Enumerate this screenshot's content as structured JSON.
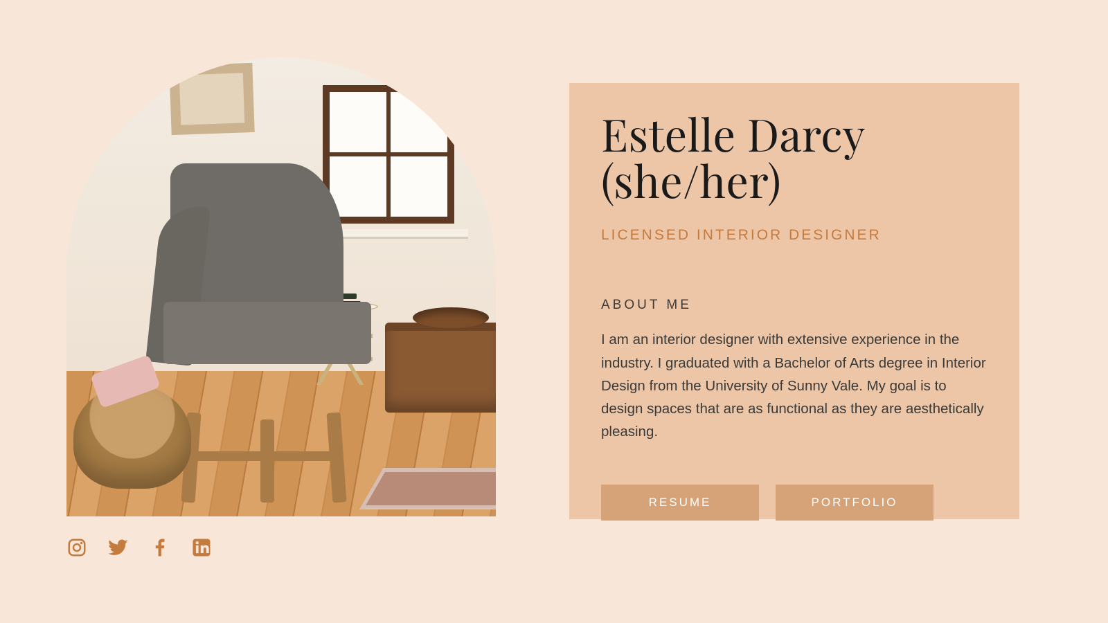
{
  "profile": {
    "name_line1": "Estelle Darcy",
    "name_line2": "(she/her)",
    "role": "LICENSED INTERIOR DESIGNER",
    "about_heading": "ABOUT ME",
    "about_body": "I am an interior designer with extensive experience in the industry. I graduated with a Bachelor of Arts degree in Interior Design from the University of Sunny Vale. My goal is to design spaces that are as functional as they are aesthetically pleasing."
  },
  "buttons": {
    "resume": "RESUME",
    "portfolio": "PORTFOLIO"
  },
  "socials": {
    "instagram": "instagram",
    "twitter": "twitter",
    "facebook": "facebook",
    "linkedin": "linkedin"
  },
  "colors": {
    "page_bg": "#f8e7d8",
    "card_bg": "#edc6a7",
    "accent": "#c57a3e",
    "button_bg": "#d6a277",
    "text_dark": "#1a1a1a"
  }
}
